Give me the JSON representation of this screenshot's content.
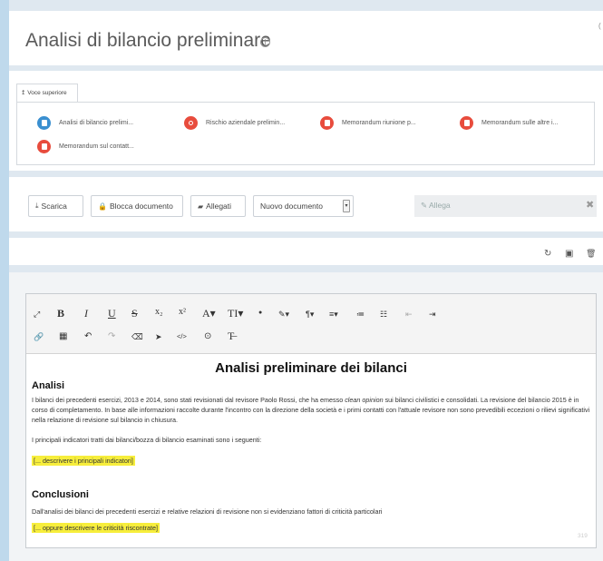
{
  "page": {
    "title": "Analisi di bilancio preliminare",
    "info_icon": "i",
    "corner_mark": "("
  },
  "parent": {
    "label": "↥ Voce superiore"
  },
  "attachments": [
    {
      "label": "Analisi di bilancio prelimi...",
      "icon": "document-icon",
      "color": "#3a8fd0"
    },
    {
      "label": "Rischio aziendale prelimin...",
      "icon": "risk-icon",
      "color": "#e84c3d"
    },
    {
      "label": "Memorandum riunione p...",
      "icon": "document-icon",
      "color": "#e84c3d"
    },
    {
      "label": "Memorandum sulle altre i...",
      "icon": "document-icon",
      "color": "#e84c3d"
    },
    {
      "label": "Memorandum sul contatt...",
      "icon": "document-icon",
      "color": "#e84c3d"
    }
  ],
  "actions": {
    "download": "Scarica",
    "lock": "Blocca documento",
    "attachments": "Allegati",
    "new_doc_selected": "Nuovo documento",
    "attach_placeholder": "✎ Allega",
    "attach_clear": "✖"
  },
  "doc_tools": {
    "refresh": "↻",
    "save": "▣",
    "delete": "🗑"
  },
  "editor_toolbar": {
    "row1": [
      "⤢",
      "B",
      "I",
      "U",
      "S",
      "x₂",
      "x²",
      "A▾",
      "TI▾",
      "●",
      "✎▾",
      "¶▾",
      "≡▾",
      "≔",
      "☷",
      "⇤",
      "⇥"
    ],
    "row2": [
      "🔗",
      "▦",
      "↶",
      "↷",
      "⌫",
      "➤",
      "</>",
      "⊙",
      "T̶"
    ]
  },
  "document": {
    "heading": "Analisi preliminare dei bilanci",
    "section1_title": "Analisi",
    "para1_start": "I bilanci dei precedenti esercizi, 2013 e 2014, sono stati revisionati dal revisore Paolo Rossi, che ha emesso ",
    "para1_emph": "clean opinion",
    "para1_end": " sui bilanci civilistici e consolidati. La revisione del bilancio 2015 è in corso di completamento. In base alle informazioni raccolte durante l'incontro con la direzione della società e i primi contatti con l'attuale revisore non sono prevedibili eccezioni o rilievi significativi nella relazione di revisione sul bilancio in chiusura.",
    "para2": "I principali indicatori tratti dai bilanci/bozza di bilancio esaminati sono i seguenti:",
    "highlight1": "[... descrivere i principali indicatori]",
    "section2_title": "Conclusioni",
    "para3": "Dall'analisi dei bilanci dei precedenti esercizi e relative relazioni di revisione non si evidenziano fattori di criticità particolari",
    "highlight2": "[... oppure descrivere le criticità riscontrate]",
    "word_count": "319"
  },
  "colors": {
    "background": "#bfd9ec",
    "panel": "#ffffff",
    "blue_icon": "#3a8fd0",
    "red_icon": "#e84c3d",
    "highlight": "#f7ee3c"
  }
}
